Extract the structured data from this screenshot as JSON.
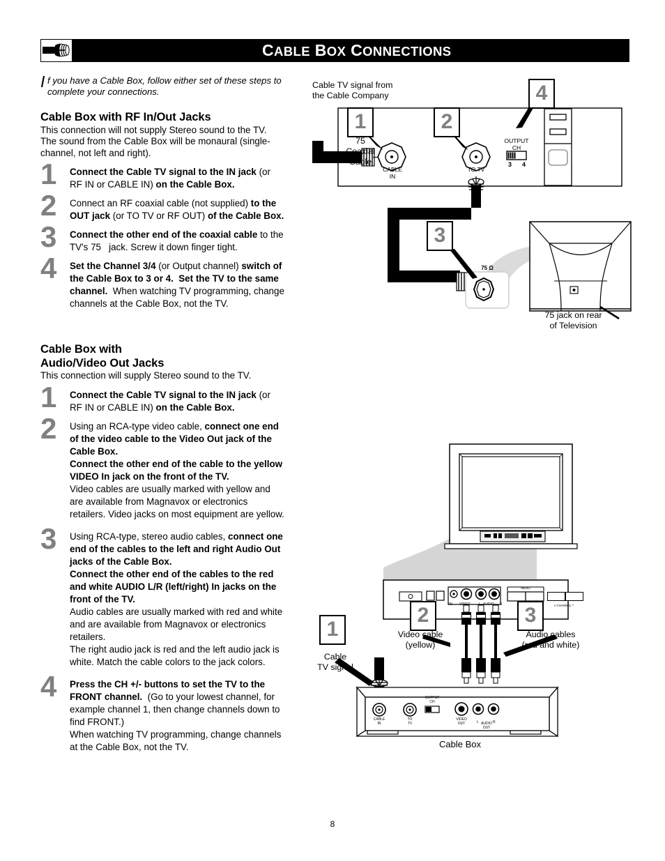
{
  "header": {
    "title_parts": [
      "C",
      "ABLE ",
      "B",
      "OX ",
      "C",
      "ONNECTIONS"
    ],
    "title": "CABLE BOX CONNECTIONS",
    "icon": "coaxial-connector-icon"
  },
  "intro": {
    "dropcap": "I",
    "text": "f you have a Cable Box, follow either set of these steps to complete your connections."
  },
  "section1": {
    "heading": "Cable Box with RF In/Out Jacks",
    "subtext": "This connection will not supply Stereo sound to the TV. The sound from the Cable Box will be monaural (single-channel, not left and right).",
    "steps": [
      {
        "num": "1",
        "html": "<b>Connect the Cable TV signal to the IN jack</b> (or RF IN or CABLE IN) <b>on the Cable Box.</b>"
      },
      {
        "num": "2",
        "html": "Connect an RF coaxial cable (not supplied) <b>to the OUT jack</b> (or TO TV or RF OUT) <b>of the Cable Box.</b>"
      },
      {
        "num": "3",
        "html": "<b>Connect the other end of the coaxial cable</b> to the TV's 75 &nbsp;&nbsp;jack. Screw it down finger tight."
      },
      {
        "num": "4",
        "html": "<b>Set the Channel 3/4</b> (or Output channel) <b>switch of the Cable Box to 3 or 4.&nbsp; Set the TV to the same channel.</b>&nbsp; When watching TV programming, change channels at the Cable Box, not the TV."
      }
    ]
  },
  "section2": {
    "heading_line1": "Cable Box with",
    "heading_line2": "Audio/Video Out Jacks",
    "subtext": "This connection will supply Stereo sound to the TV.",
    "steps": [
      {
        "num": "1",
        "html": "<b>Connect the Cable TV signal to the IN jack</b> (or RF IN or CABLE IN) <b>on the Cable Box.</b>"
      },
      {
        "num": "2",
        "html": "Using an RCA-type video cable, <b>connect one end of the video cable to the Video Out jack of the Cable Box.<br>Connect the other end of the cable to the yellow VIDEO In jack on the front of the TV.</b><br>Video cables are usually marked with yellow and are available from Magnavox or electronics retailers. Video jacks on most equipment are yellow."
      },
      {
        "num": "3",
        "html": "Using RCA-type, stereo audio cables, <b>connect one end of the cables to the left and right Audio Out jacks of the Cable Box.<br>Connect the other end of the cables to the red and white AUDIO L/R (left/right) In jacks on the front of the TV.</b><br>Audio cables are usually marked with red and white and are available from Magnavox or electronics retailers.<br>The right audio jack is red and the left audio jack is white. Match the cable colors to the jack colors."
      },
      {
        "num": "4",
        "html": "<b>Press the CH +/- buttons to set the TV to the FRONT channel.</b>&nbsp; (Go to your lowest channel, for example channel 1, then change channels down to find FRONT.)<br>When watching TV programming, change channels at the Cable Box, not the TV."
      }
    ]
  },
  "diagram_top": {
    "label_source": "Cable TV signal from\nthe Cable Company",
    "callouts": [
      "1",
      "2",
      "4"
    ],
    "jack_labels": {
      "cable_in": "CABLE\nIN",
      "to_tv": "TO TV",
      "output_ch": "OUTPUT\nCH",
      "switch_3": "3",
      "switch_4": "4"
    },
    "coax_label": "75\nCoaxial\nCable",
    "tv_callout": "3",
    "tv_jack_label": "75 Ω",
    "tv_rear_label": "75     jack on rear\nof  Television"
  },
  "diagram_bottom": {
    "callouts": [
      "1",
      "2",
      "3"
    ],
    "labels": {
      "cable_tv_signal": "Cable\nTV signal",
      "video_cable": "Video cable\n(yellow)",
      "audio_cables": "Audio cables\n(red and white)",
      "cable_box": "Cable Box"
    },
    "tv_front_jack_labels": [
      "IN",
      "VIDEO",
      "L",
      "AUDIO",
      "R"
    ],
    "tv_front_buttons": [
      "MENU",
      "- VOLUME +",
      "v  CHANNEL  ^"
    ],
    "cablebox_jack_labels": {
      "cable_in": "CABLE\nIN",
      "to_tv": "TO\nTV",
      "output_ch": "OUTPUT\nCH",
      "video_out": "VIDEO\nOUT",
      "audio_l": "L",
      "audio_out": "AUDIO\nOUT",
      "audio_r": "R"
    }
  },
  "page": {
    "number": "8"
  },
  "colors": {
    "number_gray": "#808080",
    "shadow_gray": "#d0d0d0",
    "black": "#000000"
  }
}
